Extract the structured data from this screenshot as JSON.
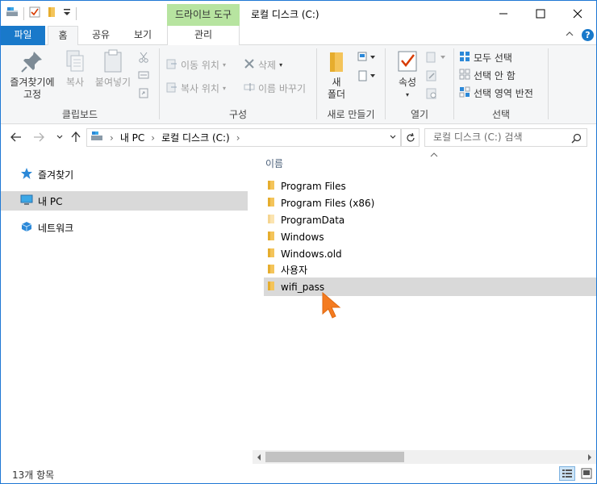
{
  "titlebar": {
    "context_tab": "드라이브 도구",
    "title": "로컬 디스크 (C:)",
    "minimize_glyph": "—",
    "maximize_glyph": "☐",
    "close_glyph": "✕"
  },
  "tabs": {
    "file": "파일",
    "home": "홈",
    "share": "공유",
    "view": "보기",
    "manage": "관리"
  },
  "ribbon": {
    "clipboard": {
      "pin_label": "즐겨찾기에\n고정",
      "copy_label": "복사",
      "paste_label": "붙여넣기",
      "group_label": "클립보드"
    },
    "organize": {
      "move_label": "이동 위치",
      "copy_to_label": "복사 위치",
      "delete_label": "삭제",
      "rename_label": "이름 바꾸기",
      "group_label": "구성"
    },
    "new": {
      "new_folder_label": "새\n폴더",
      "group_label": "새로 만들기"
    },
    "open": {
      "properties_label": "속성",
      "group_label": "열기"
    },
    "select": {
      "select_all": "모두 선택",
      "select_none": "선택 안 함",
      "invert": "선택 영역 반전",
      "group_label": "선택"
    }
  },
  "address": {
    "segments": [
      "내 PC",
      "로컬 디스크 (C:)"
    ],
    "search_placeholder": "로컬 디스크 (C:) 검색"
  },
  "navpane": {
    "items": [
      {
        "label": "즐겨찾기",
        "icon": "star-icon"
      },
      {
        "label": "내 PC",
        "icon": "pc-icon",
        "selected": true
      },
      {
        "label": "네트워크",
        "icon": "network-icon"
      }
    ]
  },
  "content": {
    "column_name": "이름",
    "files": [
      {
        "name": "Program Files"
      },
      {
        "name": "Program Files (x86)"
      },
      {
        "name": "ProgramData",
        "faded": true
      },
      {
        "name": "Windows"
      },
      {
        "name": "Windows.old"
      },
      {
        "name": "사용자"
      },
      {
        "name": "wifi_pass",
        "highlighted": true
      }
    ]
  },
  "status": {
    "count": "13개 항목"
  },
  "colors": {
    "file_tab": "#1979ca",
    "context_tab": "#b7e4a0",
    "folder": "#f4c45a",
    "cursor": "#f47b20"
  }
}
